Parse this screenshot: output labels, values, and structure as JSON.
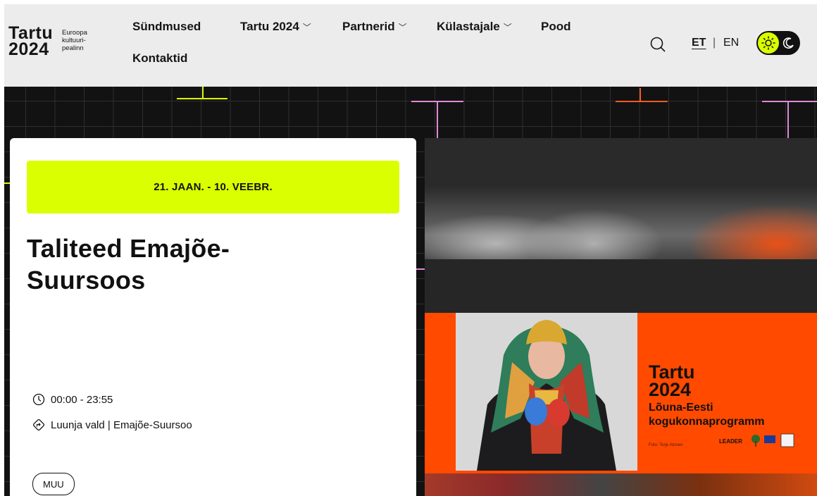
{
  "header": {
    "logo": {
      "main_line1": "Tartu",
      "main_line2": "2024",
      "sub_line1": "Euroopa",
      "sub_line2": "kultuuri-",
      "sub_line3": "pealinn"
    },
    "nav": [
      {
        "label": "Sündmused",
        "has_dropdown": false
      },
      {
        "label": "Tartu 2024",
        "has_dropdown": true
      },
      {
        "label": "Partnerid",
        "has_dropdown": true
      },
      {
        "label": "Külastajale",
        "has_dropdown": true
      },
      {
        "label": "Pood",
        "has_dropdown": false
      },
      {
        "label": "Kontaktid",
        "has_dropdown": false
      }
    ],
    "chevron": "﹀",
    "lang": {
      "current": "ET",
      "separator": "|",
      "other": "EN"
    },
    "theme_toggle": {
      "active": "light",
      "accent": "#daff00"
    }
  },
  "event": {
    "date_range": "21. JAAN. - 10. VEEBR.",
    "title": "Taliteed Emajõe-Suursoos",
    "time": "00:00 - 23:55",
    "location": "Luunja vald | Emajõe-Suursoo",
    "tag": "MUU"
  },
  "poster": {
    "brand_line1": "Tartu",
    "brand_line2": "2024",
    "subtitle_line1": "Lõuna-Eesti",
    "subtitle_line2": "kogukonnaprogramm",
    "photo_credit": "Foto: Terje Atonen",
    "sponsor": "LEADER",
    "orange": "#ff4a00"
  },
  "colors": {
    "accent": "#daff00",
    "background_dark": "#121212",
    "header_bg": "#ececec"
  }
}
